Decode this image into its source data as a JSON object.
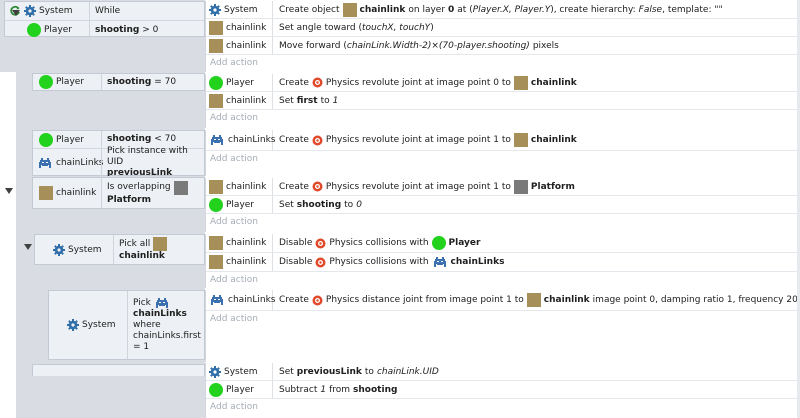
{
  "common": {
    "add_action": "Add action"
  },
  "colors": {
    "sprite": "#a78f5a",
    "player": "#22d21c",
    "platform": "#7a7a7a",
    "chainlinks": "#3a6fb0",
    "physics": "#e04a2a"
  },
  "event1": {
    "cond1_obj": "System",
    "cond1_text": "While",
    "cond2_obj": "Player",
    "cond2_var": "shooting",
    "cond2_op": "> 0",
    "actions": [
      {
        "obj": "System",
        "p1": "Create object",
        "p2": "chainlink",
        "p3": "on layer",
        "p4": "0",
        "p5": "at (",
        "p6": "Player.X, Player.Y",
        "p7": "), create hierarchy:",
        "p8": "False",
        "p9": ", template: \"\""
      },
      {
        "obj": "chainlink",
        "p1": "Set angle toward (",
        "p2": "touchX, touchY",
        "p3": ")"
      },
      {
        "obj": "chainlink",
        "p1": "Move forward (",
        "p2": "chainLink.Width-2)×(70-player.shooting)",
        "p3": "pixels"
      }
    ]
  },
  "event2": {
    "cond_obj": "Player",
    "cond_var": "shooting",
    "cond_op": "= 70",
    "actions": [
      {
        "obj": "Player",
        "p1": "Create",
        "p2": "Physics revolute joint at image point 0 to",
        "p3": "chainlink"
      },
      {
        "obj": "chainlink",
        "p1": "Set",
        "p2": "first",
        "p3": "to",
        "p4": "1"
      }
    ]
  },
  "event3": {
    "cond1_obj": "Player",
    "cond1_var": "shooting",
    "cond1_op": "< 70",
    "cond2_obj": "chainLinks",
    "cond2_text": "Pick instance with UID",
    "cond2_var": "previousLink",
    "actions": [
      {
        "obj": "chainLinks",
        "p1": "Create",
        "p2": "Physics revolute joint at image point 1 to",
        "p3": "chainlink"
      }
    ]
  },
  "event4": {
    "cond_obj": "chainlink",
    "cond_text": "Is overlapping",
    "cond_target": "Platform",
    "actions": [
      {
        "obj": "chainlink",
        "p1": "Create",
        "p2": "Physics revolute joint at image point 1 to",
        "p3": "Platform"
      },
      {
        "obj": "Player",
        "p1": "Set",
        "p2": "shooting",
        "p3": "to",
        "p4": "0"
      }
    ]
  },
  "event5": {
    "cond_obj": "System",
    "cond_text": "Pick all",
    "cond_target": "chainlink",
    "actions": [
      {
        "obj": "chainlink",
        "p1": "Disable",
        "p2": "Physics collisions with",
        "p3": "Player"
      },
      {
        "obj": "chainlink",
        "p1": "Disable",
        "p2": "Physics collisions with",
        "p3": "chainLinks"
      }
    ]
  },
  "event6": {
    "cond_obj": "System",
    "cond_text1": "Pick",
    "cond_target": "chainLinks",
    "cond_text2": "where",
    "cond_text3": "chainLinks.first",
    "cond_text4": "= 1",
    "actions": [
      {
        "obj": "chainLinks",
        "p1": "Create",
        "p2": "Physics distance joint from image point 1 to",
        "p3": "chainlink",
        "p4": "image point 0, damping ratio 1, frequency 20"
      }
    ]
  },
  "event7": {
    "actions": [
      {
        "obj": "System",
        "p1": "Set",
        "p2": "previousLink",
        "p3": "to",
        "p4": "chainLink.UID"
      },
      {
        "obj": "Player",
        "p1": "Subtract",
        "p2": "1",
        "p3": "from",
        "p4": "shooting"
      }
    ]
  }
}
